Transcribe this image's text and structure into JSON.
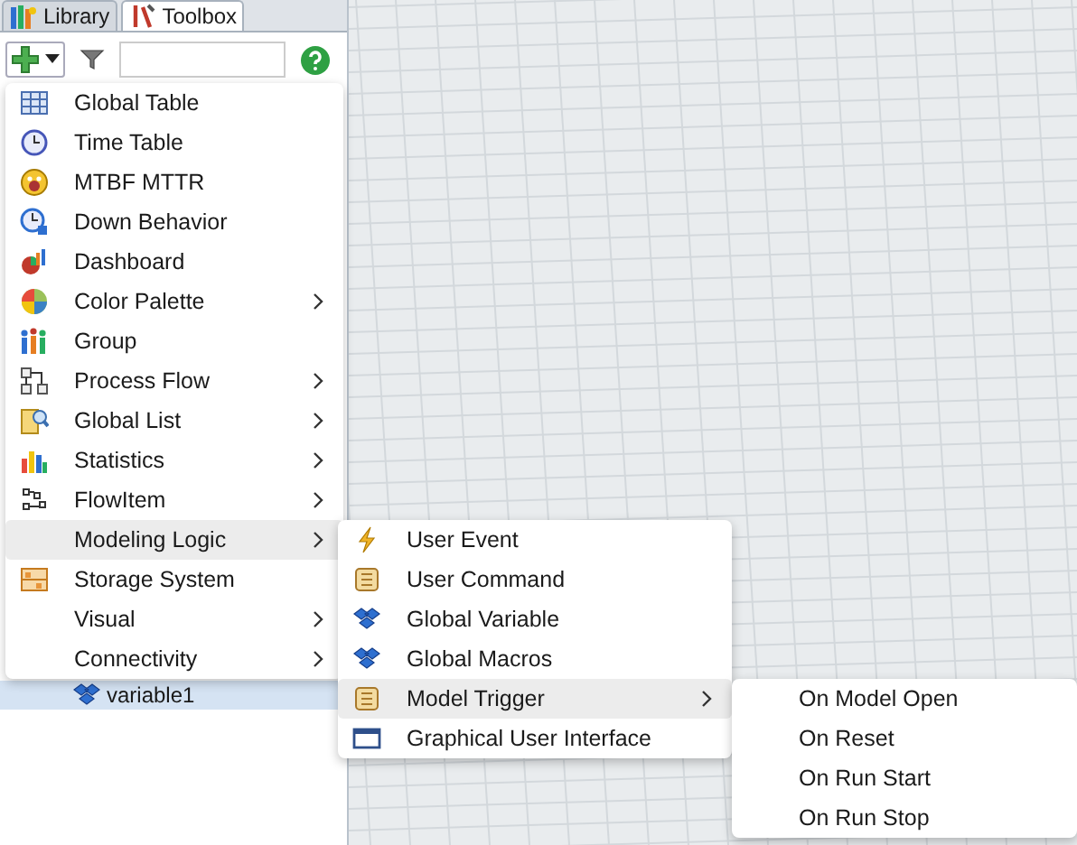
{
  "tabs": [
    {
      "label": "Library",
      "selected": false,
      "kind": "library"
    },
    {
      "label": "Toolbox",
      "selected": true,
      "kind": "tools"
    }
  ],
  "tree": {
    "items": [
      {
        "label": "variable1",
        "selected": true
      }
    ]
  },
  "menu": {
    "items": [
      {
        "label": "Global Table",
        "kind": "table",
        "submenu": false,
        "selected": false
      },
      {
        "label": "Time Table",
        "kind": "clock",
        "submenu": false,
        "selected": false
      },
      {
        "label": "MTBF MTTR",
        "kind": "warning",
        "submenu": false,
        "selected": false
      },
      {
        "label": "Down Behavior",
        "kind": "clockdown",
        "submenu": false,
        "selected": false
      },
      {
        "label": "Dashboard",
        "kind": "dashboard",
        "submenu": false,
        "selected": false
      },
      {
        "label": "Color Palette",
        "kind": "palette",
        "submenu": true,
        "selected": false
      },
      {
        "label": "Group",
        "kind": "group",
        "submenu": false,
        "selected": false
      },
      {
        "label": "Process Flow",
        "kind": "flow",
        "submenu": true,
        "selected": false
      },
      {
        "label": "Global List",
        "kind": "list",
        "submenu": true,
        "selected": false
      },
      {
        "label": "Statistics",
        "kind": "stats",
        "submenu": true,
        "selected": false
      },
      {
        "label": "FlowItem",
        "kind": "flowitem",
        "submenu": true,
        "selected": false
      },
      {
        "label": "Modeling Logic",
        "kind": "plain",
        "submenu": true,
        "selected": true
      },
      {
        "label": "Storage System",
        "kind": "storage",
        "submenu": false,
        "selected": false
      },
      {
        "label": "Visual",
        "kind": "plain",
        "submenu": true,
        "selected": false
      },
      {
        "label": "Connectivity",
        "kind": "plain",
        "submenu": true,
        "selected": false
      }
    ]
  },
  "submenu": {
    "items": [
      {
        "label": "User Event",
        "kind": "bolt",
        "submenu": false,
        "selected": false
      },
      {
        "label": "User Command",
        "kind": "scroll",
        "submenu": false,
        "selected": false
      },
      {
        "label": "Global Variable",
        "kind": "cubes",
        "submenu": false,
        "selected": false
      },
      {
        "label": "Global Macros",
        "kind": "cubes",
        "submenu": false,
        "selected": false
      },
      {
        "label": "Model Trigger",
        "kind": "scroll",
        "submenu": true,
        "selected": true
      },
      {
        "label": "Graphical User Interface",
        "kind": "window",
        "submenu": false,
        "selected": false
      }
    ]
  },
  "trigger_menu": {
    "items": [
      {
        "label": "On Model Open",
        "selected": false
      },
      {
        "label": "On Reset",
        "selected": false
      },
      {
        "label": "On Run Start",
        "selected": false
      },
      {
        "label": "On Run Stop",
        "selected": false
      }
    ]
  }
}
